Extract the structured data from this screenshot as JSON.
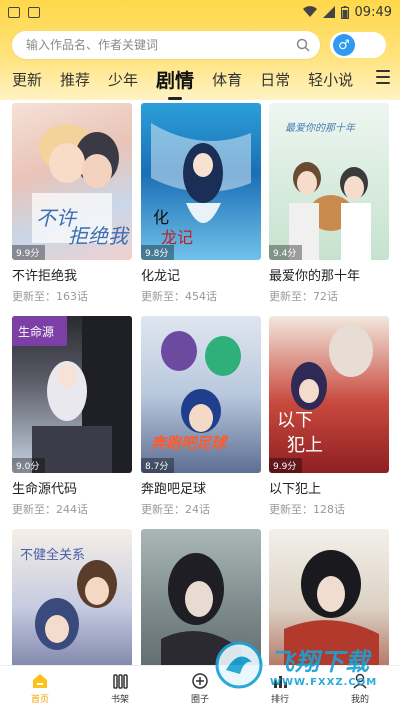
{
  "statusbar": {
    "time": "09:49"
  },
  "search": {
    "placeholder": "输入作品名、作者关键词"
  },
  "gender_toggle": {
    "symbol": "♂",
    "color": "#2f9af2"
  },
  "tabs": [
    {
      "label": "更新"
    },
    {
      "label": "推荐"
    },
    {
      "label": "少年"
    },
    {
      "label": "剧情",
      "active": true
    },
    {
      "label": "体育"
    },
    {
      "label": "日常"
    },
    {
      "label": "轻小说"
    }
  ],
  "comics": [
    {
      "title": "不许拒绝我",
      "update": "更新至：163话",
      "score": "9.9分"
    },
    {
      "title": "化龙记",
      "update": "更新至：454话",
      "score": "9.8分"
    },
    {
      "title": "最爱你的那十年",
      "update": "更新至：72话",
      "score": "9.4分"
    },
    {
      "title": "生命源代码",
      "update": "更新至：244话",
      "score": "9.0分"
    },
    {
      "title": "奔跑吧足球",
      "update": "更新至：24话",
      "score": "8.7分"
    },
    {
      "title": "以下犯上",
      "update": "更新至：128话",
      "score": "9.9分"
    },
    {
      "title": "",
      "update": "",
      "score": ""
    },
    {
      "title": "",
      "update": "",
      "score": ""
    },
    {
      "title": "",
      "update": "",
      "score": ""
    }
  ],
  "bottom_nav": [
    {
      "label": "首页",
      "icon": "home-icon",
      "active": true
    },
    {
      "label": "书架",
      "icon": "bookshelf-icon"
    },
    {
      "label": "圈子",
      "icon": "circle-icon"
    },
    {
      "label": "排行",
      "icon": "ranking-icon"
    },
    {
      "label": "我的",
      "icon": "profile-icon"
    }
  ],
  "watermark": {
    "big": "飞翔下载",
    "small": "WWW.FXXZ.COM"
  },
  "colors": {
    "accent": "#ffd84a",
    "active_nav": "#f5a300"
  }
}
